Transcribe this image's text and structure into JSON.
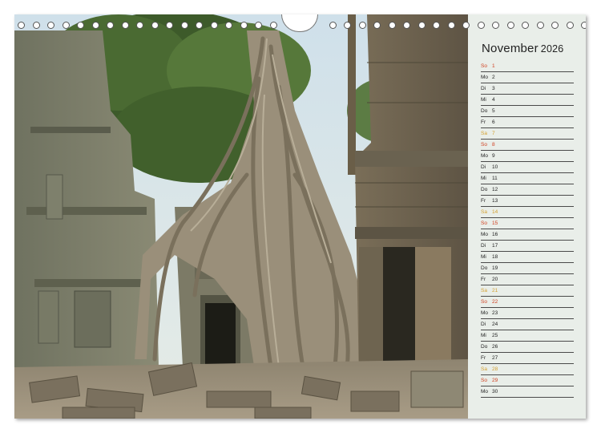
{
  "calendar": {
    "month": "November",
    "year": "2026",
    "days": [
      {
        "dn": "So",
        "dd": "1",
        "type": "so"
      },
      {
        "dn": "Mo",
        "dd": "2",
        "type": "wd"
      },
      {
        "dn": "Di",
        "dd": "3",
        "type": "wd"
      },
      {
        "dn": "Mi",
        "dd": "4",
        "type": "wd"
      },
      {
        "dn": "Do",
        "dd": "5",
        "type": "wd"
      },
      {
        "dn": "Fr",
        "dd": "6",
        "type": "wd"
      },
      {
        "dn": "Sa",
        "dd": "7",
        "type": "sa"
      },
      {
        "dn": "So",
        "dd": "8",
        "type": "so"
      },
      {
        "dn": "Mo",
        "dd": "9",
        "type": "wd"
      },
      {
        "dn": "Di",
        "dd": "10",
        "type": "wd"
      },
      {
        "dn": "Mi",
        "dd": "11",
        "type": "wd"
      },
      {
        "dn": "Do",
        "dd": "12",
        "type": "wd"
      },
      {
        "dn": "Fr",
        "dd": "13",
        "type": "wd"
      },
      {
        "dn": "Sa",
        "dd": "14",
        "type": "sa"
      },
      {
        "dn": "So",
        "dd": "15",
        "type": "so"
      },
      {
        "dn": "Mo",
        "dd": "16",
        "type": "wd"
      },
      {
        "dn": "Di",
        "dd": "17",
        "type": "wd"
      },
      {
        "dn": "Mi",
        "dd": "18",
        "type": "wd"
      },
      {
        "dn": "Do",
        "dd": "19",
        "type": "wd"
      },
      {
        "dn": "Fr",
        "dd": "20",
        "type": "wd"
      },
      {
        "dn": "Sa",
        "dd": "21",
        "type": "sa"
      },
      {
        "dn": "So",
        "dd": "22",
        "type": "so"
      },
      {
        "dn": "Mo",
        "dd": "23",
        "type": "wd"
      },
      {
        "dn": "Di",
        "dd": "24",
        "type": "wd"
      },
      {
        "dn": "Mi",
        "dd": "25",
        "type": "wd"
      },
      {
        "dn": "Do",
        "dd": "26",
        "type": "wd"
      },
      {
        "dn": "Fr",
        "dd": "27",
        "type": "wd"
      },
      {
        "dn": "Sa",
        "dd": "28",
        "type": "sa"
      },
      {
        "dn": "So",
        "dd": "29",
        "type": "so"
      },
      {
        "dn": "Mo",
        "dd": "30",
        "type": "wd"
      }
    ]
  },
  "colors": {
    "sunday": "#d04020",
    "saturday": "#d4a030",
    "weekday": "#222222",
    "sidebar": "#e9eee9"
  },
  "photo": {
    "subject_icon": "temple-ruins-tree-roots-photo"
  }
}
